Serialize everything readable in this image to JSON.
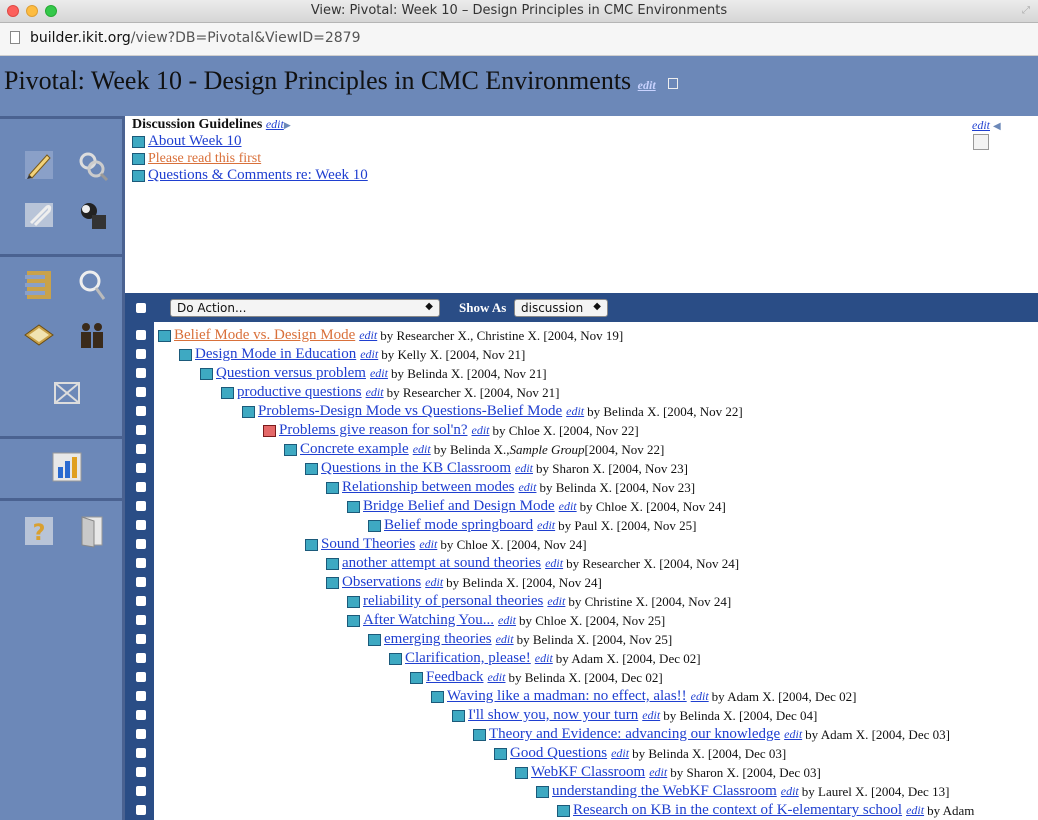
{
  "window": {
    "title": "View: Pivotal: Week 10 – Design Principles in CMC Environments"
  },
  "address": {
    "host": "builder.ikit.org",
    "path": "/view?DB=Pivotal&ViewID=2879"
  },
  "page": {
    "title": "Pivotal: Week 10 - Design Principles in CMC Environments",
    "edit_label": "edit"
  },
  "guidelines": {
    "title": "Discussion Guidelines",
    "edit_label": "edit",
    "items": [
      {
        "label": "About Week 10",
        "visited": false
      },
      {
        "label": "Please read this first",
        "visited": true
      },
      {
        "label": "Questions & Comments re: Week 10",
        "visited": false
      }
    ]
  },
  "topright": {
    "edit_label": "edit"
  },
  "actionbar": {
    "action_select": "Do Action...",
    "show_as_label": "Show As",
    "show_as_select": "discussion"
  },
  "thread": [
    {
      "level": 0,
      "title": "Belief Mode vs. Design Mode ",
      "by": "by Researcher X., Christine X. [2004, Nov 19]",
      "visited": true,
      "red": false
    },
    {
      "level": 1,
      "title": "Design Mode in Education",
      "by": "by Kelly X. [2004, Nov 21]",
      "visited": false,
      "red": false
    },
    {
      "level": 2,
      "title": "Question versus problem",
      "by": "by Belinda X. [2004, Nov 21]",
      "visited": false,
      "red": false
    },
    {
      "level": 3,
      "title": "productive questions ",
      "by": "by Researcher X. [2004, Nov 21]",
      "visited": false,
      "red": false
    },
    {
      "level": 4,
      "title": "Problems-Design Mode vs Questions-Belief Mode",
      "by": "by Belinda X. [2004, Nov 22]",
      "visited": false,
      "red": false
    },
    {
      "level": 5,
      "title": "Problems give reason for sol'n?",
      "by": "by Chloe X. [2004, Nov 22]",
      "visited": false,
      "red": true
    },
    {
      "level": 6,
      "title": "Concrete example",
      "by": "by Belinda X., ",
      "group": "Sample Group",
      "date": " [2004, Nov 22]",
      "visited": false,
      "red": false
    },
    {
      "level": 7,
      "title": "Questions in the KB Classroom",
      "by": "by Sharon X. [2004, Nov 23]",
      "visited": false,
      "red": false
    },
    {
      "level": 8,
      "title": "Relationship between modes",
      "by": "by Belinda X. [2004, Nov 23]",
      "visited": false,
      "red": false
    },
    {
      "level": 9,
      "title": "Bridge Belief and Design Mode",
      "by": "by Chloe X. [2004, Nov 24]",
      "visited": false,
      "red": false
    },
    {
      "level": 10,
      "title": "Belief mode springboard",
      "by": "by Paul X. [2004, Nov 25]",
      "visited": false,
      "red": false
    },
    {
      "level": 7,
      "title": "Sound Theories",
      "by": "by Chloe X. [2004, Nov 24]",
      "visited": false,
      "red": false
    },
    {
      "level": 8,
      "title": "another attempt at sound theories",
      "by": "by Researcher X. [2004, Nov 24]",
      "visited": false,
      "red": false
    },
    {
      "level": 8,
      "title": "Observations",
      "by": "by Belinda X. [2004, Nov 24]",
      "visited": false,
      "red": false
    },
    {
      "level": 9,
      "title": "reliability of personal theories",
      "by": "by Christine X. [2004, Nov 24]",
      "visited": false,
      "red": false
    },
    {
      "level": 9,
      "title": "After Watching You...",
      "by": "by Chloe X. [2004, Nov 25]",
      "visited": false,
      "red": false
    },
    {
      "level": 10,
      "title": "emerging theories",
      "by": "by Belinda X. [2004, Nov 25]",
      "visited": false,
      "red": false
    },
    {
      "level": 11,
      "title": "Clarification, please!",
      "by": "by Adam X. [2004, Dec 02]",
      "visited": false,
      "red": false
    },
    {
      "level": 12,
      "title": "Feedback",
      "by": "by Belinda X. [2004, Dec 02]",
      "visited": false,
      "red": false
    },
    {
      "level": 13,
      "title": "Waving like a madman: no effect, alas!!",
      "by": "by Adam X. [2004, Dec 02]",
      "visited": false,
      "red": false
    },
    {
      "level": 14,
      "title": "I'll show you, now your turn",
      "by": "by Belinda X. [2004, Dec 04]",
      "visited": false,
      "red": false
    },
    {
      "level": 15,
      "title": "Theory and Evidence: advancing our knowledge",
      "by": "by Adam X. [2004, Dec 03]",
      "visited": false,
      "red": false
    },
    {
      "level": 16,
      "title": "Good Questions",
      "by": "by Belinda X. [2004, Dec 03]",
      "visited": false,
      "red": false
    },
    {
      "level": 17,
      "title": "WebKF Classroom",
      "by": "by Sharon X. [2004, Dec 03]",
      "visited": false,
      "red": false
    },
    {
      "level": 18,
      "title": "understanding the WebKF Classroom",
      "by": "by Laurel X. [2004, Dec 13]",
      "visited": false,
      "red": false
    },
    {
      "level": 19,
      "title": "Research on KB in the context of K-elementary school",
      "by": "by Adam",
      "visited": false,
      "red": false
    }
  ],
  "thread_edit_label": "edit",
  "colors": {
    "header": "#6c88b8",
    "actionbar": "#2a4d86",
    "link": "#1f3fd0",
    "visited": "#d9703a",
    "note": "#3ea9c2"
  },
  "tools": [
    "pencil-icon",
    "search-icon",
    "paperclip-icon",
    "magnifier-person-icon",
    "scaffold-icon",
    "lens-icon",
    "book-icon",
    "people-icon",
    "chart-icon",
    "bar-chart-icon",
    "help-icon",
    "door-icon"
  ]
}
